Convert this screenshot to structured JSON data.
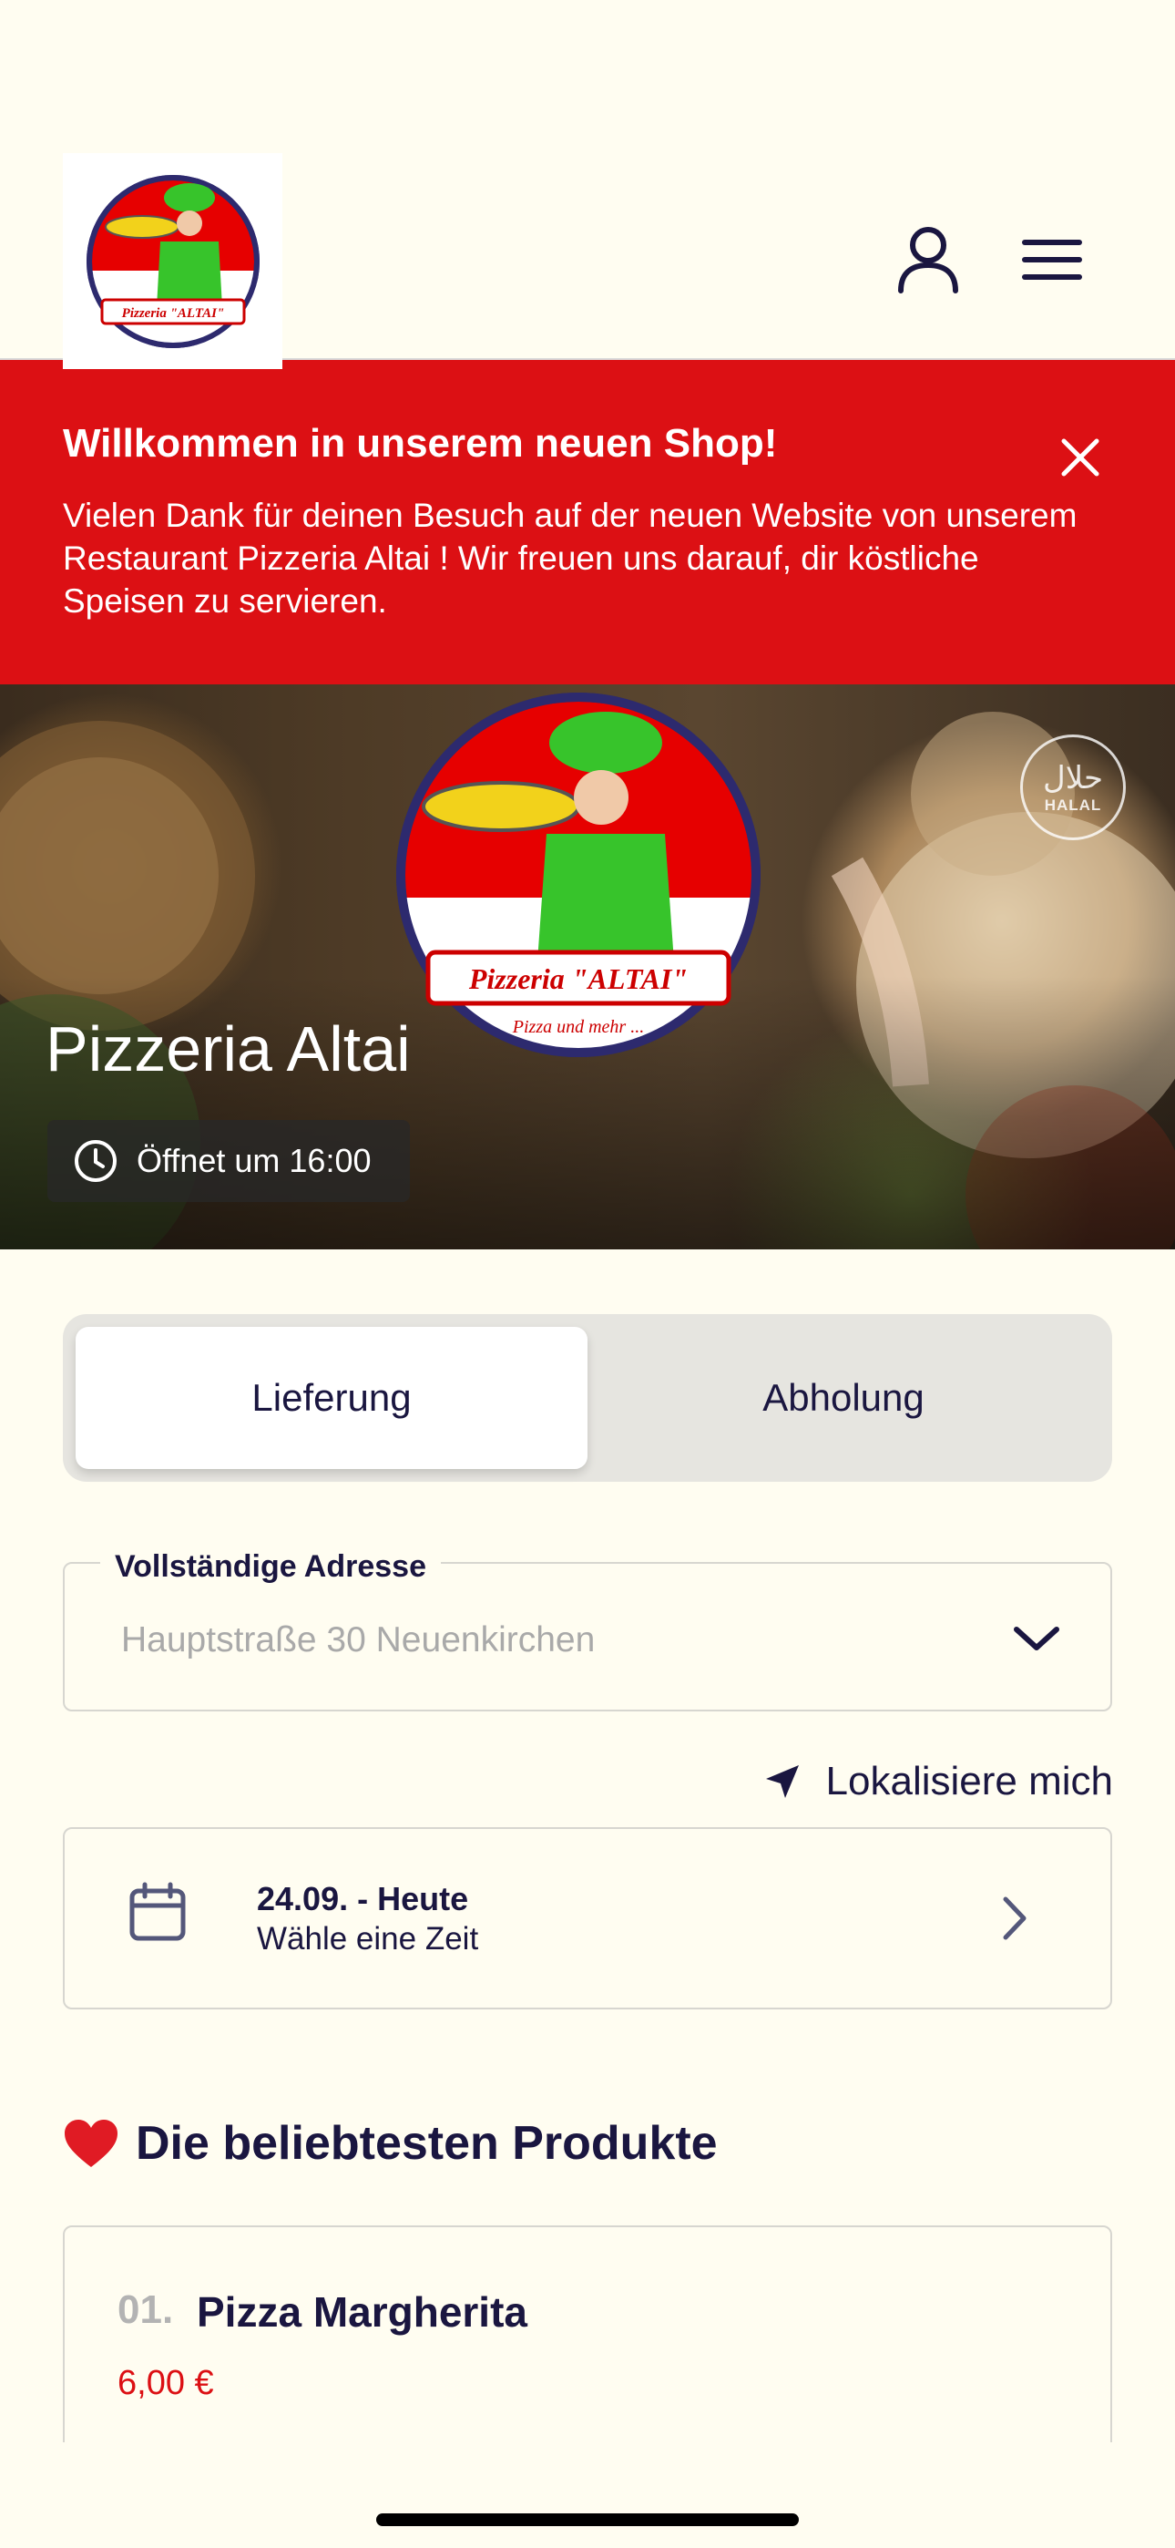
{
  "header": {
    "logo_alt": "Pizzeria \"ALTAI\" logo",
    "account_icon": "user-icon",
    "menu_icon": "hamburger-icon"
  },
  "banner": {
    "title": "Willkommen in unserem neuen Shop!",
    "text": "Vielen Dank für deinen Besuch auf der neuen Website von unserem Restaurant Pizzeria Altai ! Wir freuen uns darauf, dir köstliche Speisen zu servieren.",
    "close_icon": "close-icon",
    "bg_color": "#dc1014"
  },
  "hero": {
    "restaurant_name": "Pizzeria Altai",
    "logo_text": "Pizzeria \"ALTAI\"",
    "logo_tagline": "Pizza und mehr ...",
    "halal_arabic": "حلال",
    "halal_label": "HALAL",
    "hours_text": "Öffnet um 16:00"
  },
  "mode": {
    "options": [
      "Lieferung",
      "Abholung"
    ],
    "selected": "Lieferung"
  },
  "address": {
    "label": "Vollständige Adresse",
    "placeholder": "Hauptstraße 30 Neuenkirchen",
    "locate_label": "Lokalisiere mich"
  },
  "schedule": {
    "date": "24.09. - Heute",
    "time_prompt": "Wähle eine Zeit"
  },
  "popular": {
    "title": "Die beliebtesten Produkte",
    "products": [
      {
        "rank": "01.",
        "name": "Pizza Margherita",
        "price": "6,00 €"
      }
    ]
  }
}
